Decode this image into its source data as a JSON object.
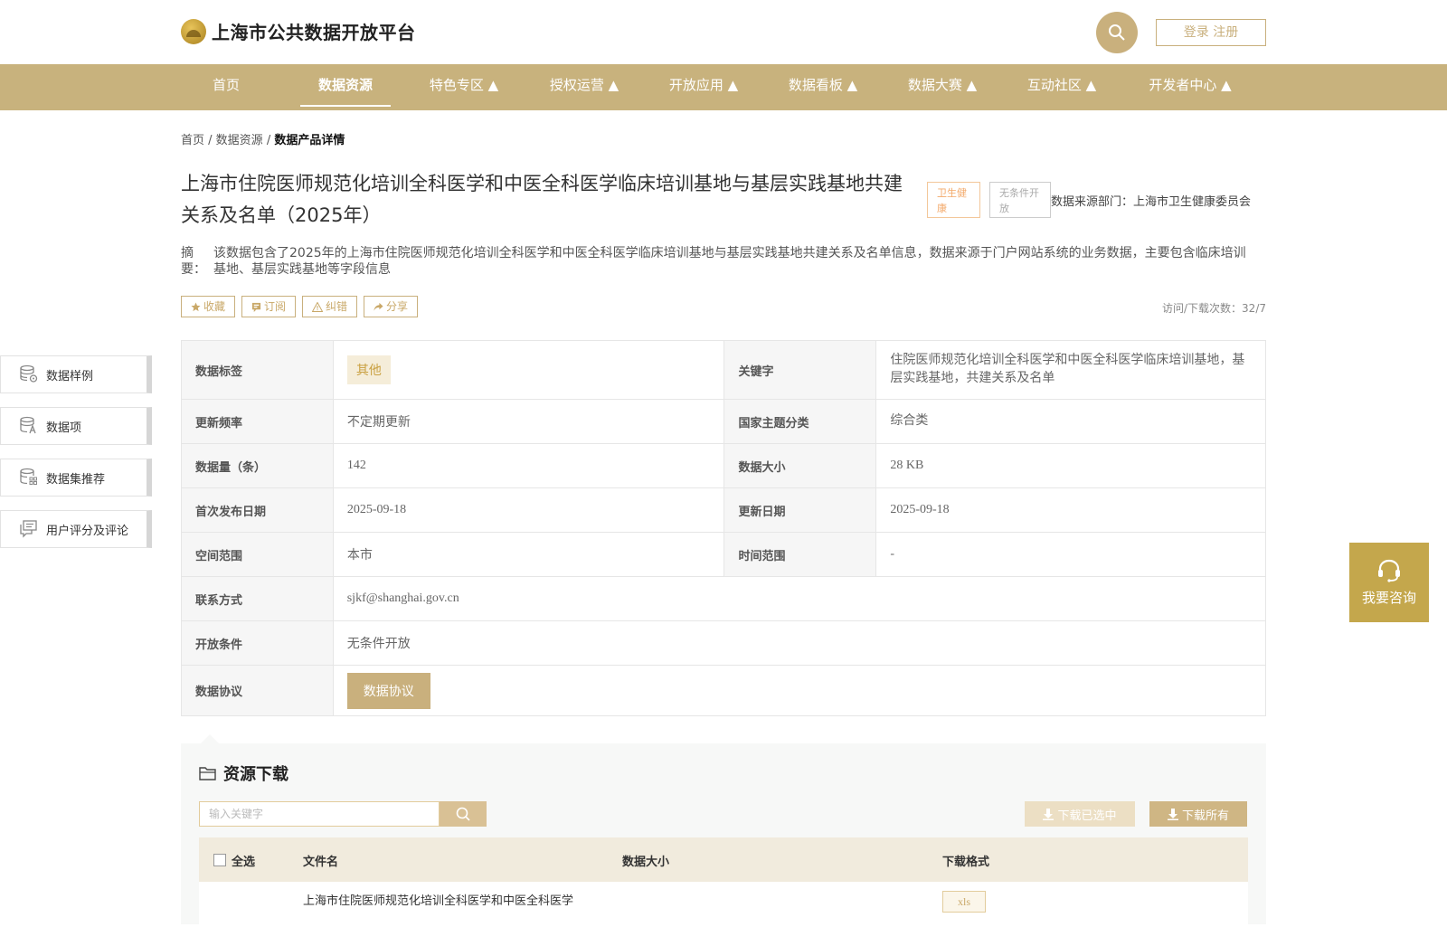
{
  "header": {
    "logo_text": "上海市公共数据开放平台",
    "login_label": "登录 注册"
  },
  "nav": {
    "items": [
      "首页",
      "数据资源",
      "特色专区 ▲",
      "授权运营 ▲",
      "开放应用 ▲",
      "数据看板 ▲",
      "数据大赛 ▲",
      "互动社区 ▲",
      "开发者中心 ▲"
    ],
    "active": "数据资源"
  },
  "breadcrumb": {
    "home": "首页",
    "sep": " / ",
    "resources": "数据资源",
    "current": "数据产品详情"
  },
  "dataset": {
    "title": "上海市住院医师规范化培训全科医学和中医全科医学临床培训基地与基层实践基地共建关系及名单（2025年）",
    "tag_health": "卫生健康",
    "tag_open": "无条件开放",
    "source": "数据来源部门：上海市卫生健康委员会",
    "abstract_label": "摘要：",
    "abstract": "该数据包含了2025年的上海市住院医师规范化培训全科医学和中医全科医学临床培训基地与基层实践基地共建关系及名单信息，数据来源于门户网站系统的业务数据，主要包含临床培训基地、基层实践基地等字段信息",
    "visits": "访问/下载次数：32/7"
  },
  "actions": {
    "favorite": "收藏",
    "subscribe": "订阅",
    "report": "纠错",
    "share": "分享"
  },
  "sidebar": {
    "items": [
      "数据样例",
      "数据项",
      "数据集推荐",
      "用户评分及评论"
    ]
  },
  "info": {
    "labels": {
      "tag": "数据标签",
      "keyword": "关键字",
      "frequency": "更新频率",
      "theme": "国家主题分类",
      "count": "数据量（条）",
      "size": "数据大小",
      "first_pub": "首次发布日期",
      "updated": "更新日期",
      "space": "空间范围",
      "time": "时间范围",
      "contact": "联系方式",
      "condition": "开放条件",
      "agreement": "数据协议"
    },
    "values": {
      "tag": "其他",
      "keyword": "住院医师规范化培训全科医学和中医全科医学临床培训基地，基层实践基地，共建关系及名单",
      "frequency": "不定期更新",
      "theme": "综合类",
      "count": "142",
      "size": "28 KB",
      "first_pub": "2025-09-18",
      "updated": "2025-09-18",
      "space": "本市",
      "time": "-",
      "contact": "sjkf@shanghai.gov.cn",
      "condition": "无条件开放",
      "agreement_btn": "数据协议"
    }
  },
  "resources": {
    "title": "资源下载",
    "search_placeholder": "输入关键字",
    "download_selected": "下载已选中",
    "download_all": "下载所有",
    "col_select_all": "全选",
    "col_filename": "文件名",
    "col_size": "数据大小",
    "col_format": "下载格式",
    "row1_name": "上海市住院医师规范化培训全科医学和中医全科医学",
    "row1_format": "xls"
  },
  "consult": {
    "label": "我要咨询"
  },
  "colors": {
    "brand_gold": "#c8b27d",
    "consult_gold": "#c4a74c"
  }
}
